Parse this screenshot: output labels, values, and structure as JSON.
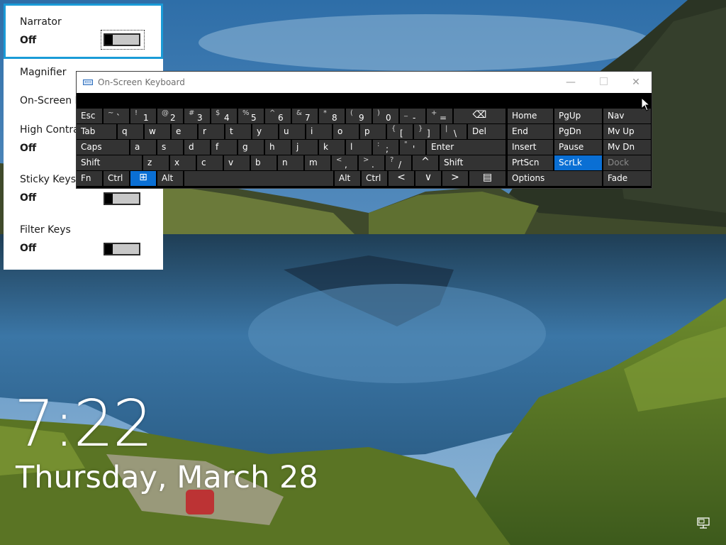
{
  "accessibility_flyout": {
    "items": [
      {
        "label": "Narrator",
        "state": "Off",
        "has_toggle": true
      },
      {
        "label": "Magnifier",
        "state": "",
        "has_toggle": false
      },
      {
        "label": "On-Screen K",
        "state": "",
        "has_toggle": false
      },
      {
        "label": "High Contra",
        "state": "Off",
        "has_toggle": false
      },
      {
        "label": "Sticky Keys",
        "state": "Off",
        "has_toggle": true
      },
      {
        "label": "Filter Keys",
        "state": "Off",
        "has_toggle": true
      }
    ]
  },
  "osk": {
    "title": "On-Screen Keyboard",
    "minimize": "—",
    "close": "✕",
    "row1": [
      {
        "l": "Esc"
      },
      {
        "s": "~",
        "m": "`"
      },
      {
        "s": "!",
        "m": "1"
      },
      {
        "s": "@",
        "m": "2"
      },
      {
        "s": "#",
        "m": "3"
      },
      {
        "s": "$",
        "m": "4"
      },
      {
        "s": "%",
        "m": "5"
      },
      {
        "s": "^",
        "m": "6"
      },
      {
        "s": "&",
        "m": "7"
      },
      {
        "s": "*",
        "m": "8"
      },
      {
        "s": "(",
        "m": "9"
      },
      {
        "s": ")",
        "m": "0"
      },
      {
        "s": "_",
        "m": "-"
      },
      {
        "s": "+",
        "m": "="
      },
      {
        "l": "⌫"
      }
    ],
    "row2": [
      {
        "l": "Tab"
      },
      {
        "l": "q"
      },
      {
        "l": "w"
      },
      {
        "l": "e"
      },
      {
        "l": "r"
      },
      {
        "l": "t"
      },
      {
        "l": "y"
      },
      {
        "l": "u"
      },
      {
        "l": "i"
      },
      {
        "l": "o"
      },
      {
        "l": "p"
      },
      {
        "s": "{",
        "m": "["
      },
      {
        "s": "}",
        "m": "]"
      },
      {
        "s": "|",
        "m": "\\"
      },
      {
        "l": "Del"
      }
    ],
    "row3": [
      {
        "l": "Caps"
      },
      {
        "l": "a"
      },
      {
        "l": "s"
      },
      {
        "l": "d"
      },
      {
        "l": "f"
      },
      {
        "l": "g"
      },
      {
        "l": "h"
      },
      {
        "l": "j"
      },
      {
        "l": "k"
      },
      {
        "l": "l"
      },
      {
        "s": ":",
        "m": ";"
      },
      {
        "s": "\"",
        "m": "'"
      },
      {
        "l": "Enter"
      }
    ],
    "row4": [
      {
        "l": "Shift"
      },
      {
        "l": "z"
      },
      {
        "l": "x"
      },
      {
        "l": "c"
      },
      {
        "l": "v"
      },
      {
        "l": "b"
      },
      {
        "l": "n"
      },
      {
        "l": "m"
      },
      {
        "s": "<",
        "m": ","
      },
      {
        "s": ">",
        "m": "."
      },
      {
        "s": "?",
        "m": "/"
      },
      {
        "l": "^"
      },
      {
        "l": "Shift"
      }
    ],
    "row5": [
      {
        "l": "Fn"
      },
      {
        "l": "Ctrl"
      },
      {
        "l": "⊞"
      },
      {
        "l": "Alt"
      },
      {
        "l": ""
      },
      {
        "l": "Alt"
      },
      {
        "l": "Ctrl"
      },
      {
        "l": "<"
      },
      {
        "l": "∨"
      },
      {
        "l": ">"
      },
      {
        "l": "▤"
      }
    ],
    "nav_keys": [
      {
        "l": "Home"
      },
      {
        "l": "PgUp"
      },
      {
        "l": "Nav"
      },
      {
        "l": "End"
      },
      {
        "l": "PgDn"
      },
      {
        "l": "Mv Up"
      },
      {
        "l": "Insert"
      },
      {
        "l": "Pause"
      },
      {
        "l": "Mv Dn"
      },
      {
        "l": "PrtScn"
      },
      {
        "l": "ScrLk",
        "active": true
      },
      {
        "l": "Dock",
        "dim": true
      },
      {
        "l": "Options"
      },
      {
        "l": "Fade"
      }
    ]
  },
  "clock": {
    "time": "7:22",
    "date": "Thursday, March 28"
  },
  "colors": {
    "accent": "#0a6fd4",
    "focus_outline": "#1a9bd7",
    "key_bg": "#333333"
  }
}
